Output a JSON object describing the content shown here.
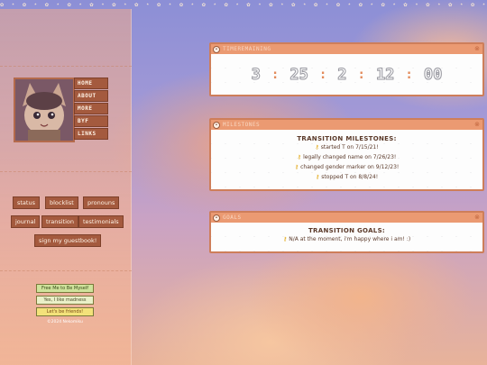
{
  "top_border": "✿ ⋆ ✿ ⋆ ✿ ⋆ ✿ ⋆ ✿ ⋆ ✿ ⋆ ✿ ⋆ ✿ ⋆ ✿ ⋆ ✿ ⋆ ✿ ⋆ ✿ ⋆ ✿ ⋆ ✿ ⋆ ✿ ⋆ ✿ ⋆ ✿ ⋆ ✿ ⋆ ✿ ⋆ ✿ ⋆ ✿ ⋆ ✿ ⋆ ✿ ⋆ ✿",
  "sidebar": {
    "nav": [
      "HOME",
      "ABOUT",
      "MORE",
      "BYF",
      "LINKS"
    ],
    "buttons": [
      "status",
      "blocklist",
      "pronouns",
      "journal",
      "transition",
      "testimonials",
      "sign my guestbook!"
    ],
    "stamps": [
      "Free Me to Be Myself",
      "Yes, I like madness",
      "Let's be friends!"
    ],
    "copyright": "©2024 Nekomiku"
  },
  "panels": {
    "countdown": {
      "title": "TIMEREMAINING",
      "values": [
        "3",
        "25",
        "2",
        "12",
        "00"
      ],
      "separator": ":"
    },
    "milestones": {
      "title": "MILESTONES",
      "heading": "TRANSITION MILESTONES:",
      "items": [
        "started T on 7/15/21!",
        "legally changed name on 7/26/23!",
        "changed gender marker on 9/12/23!",
        "stopped T on 8/8/24!"
      ]
    },
    "goals": {
      "title": "GOALS",
      "heading": "TRANSITION GOALS:",
      "items": [
        "N/A at the moment, i'm happy where i am! :)"
      ]
    }
  },
  "colors": {
    "accent": "#eb9a72",
    "button": "#a45a3e",
    "text": "#5b3a2a"
  }
}
